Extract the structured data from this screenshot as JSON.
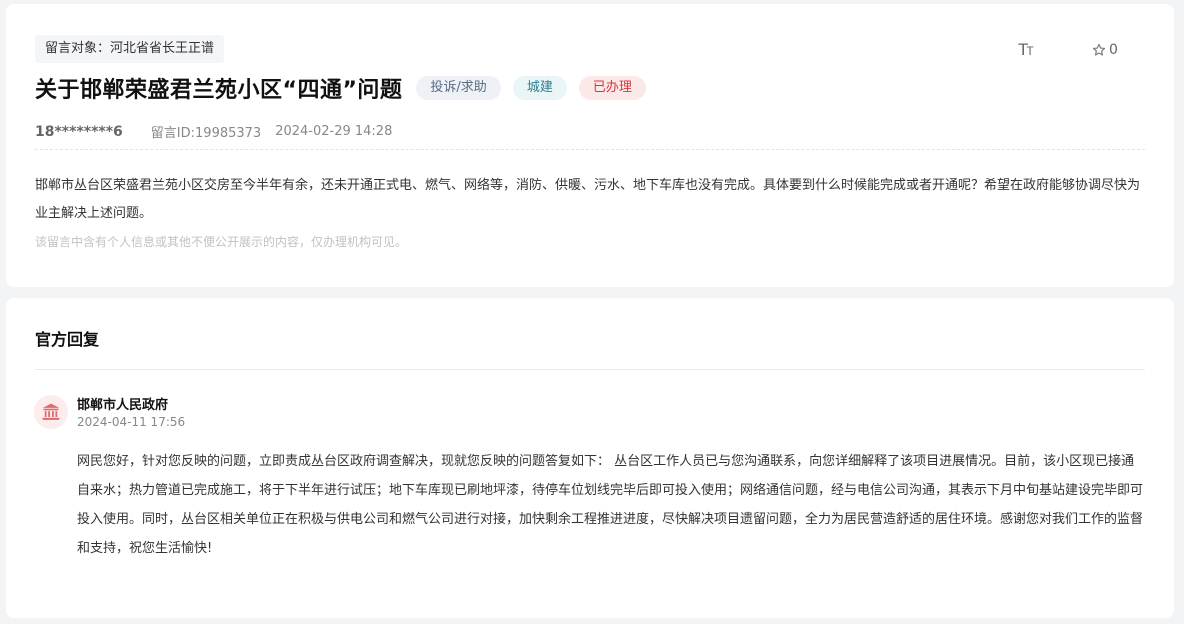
{
  "message": {
    "target_label": "留言对象：河北省省长王正谱",
    "font_size_toggle": "TT",
    "favorite_count": "0",
    "title": "关于邯郸荣盛君兰苑小区“四通”问题",
    "category_badge": "投诉/求助",
    "department_badge": "城建",
    "status_badge": "已办理",
    "user": "18********6",
    "message_id": "留言ID:19985373",
    "date": "2024-02-29 14:28",
    "content": "邯郸市丛台区荣盛君兰苑小区交房至今半年有余，还未开通正式电、燃气、网络等，消防、供暖、污水、地下车库也没有完成。具体要到什么时候能完成或者开通呢？希望在政府能够协调尽快为业主解决上述问题。",
    "privacy_note": "该留言中含有个人信息或其他不便公开展示的内容，仅办理机构可见。"
  },
  "reply": {
    "header": "官方回复",
    "org_name": "邯郸市人民政府",
    "time": "2024-04-11 17:56",
    "content": "网民您好，针对您反映的问题，立即责成丛台区政府调查解决，现就您反映的问题答复如下： 丛台区工作人员已与您沟通联系，向您详细解释了该项目进展情况。目前，该小区现已接通自来水；热力管道已完成施工，将于下半年进行试压；地下车库现已刷地坪漆，待停车位划线完毕后即可投入使用；网络通信问题，经与电信公司沟通，其表示下月中旬基站建设完毕即可投入使用。同时，丛台区相关单位正在积极与供电公司和燃气公司进行对接，加快剩余工程推进进度，尽快解决项目遗留问题，全力为居民营造舒适的居住环境。感谢您对我们工作的监督和支持，祝您生活愉快!"
  },
  "colors": {
    "status_red": "#d9363e",
    "department_teal": "#2f7f95",
    "category_gray": "#5b6b82"
  },
  "icons": {
    "font_size": "font-size-icon",
    "favorite": "star-icon",
    "government": "government-building-icon"
  }
}
